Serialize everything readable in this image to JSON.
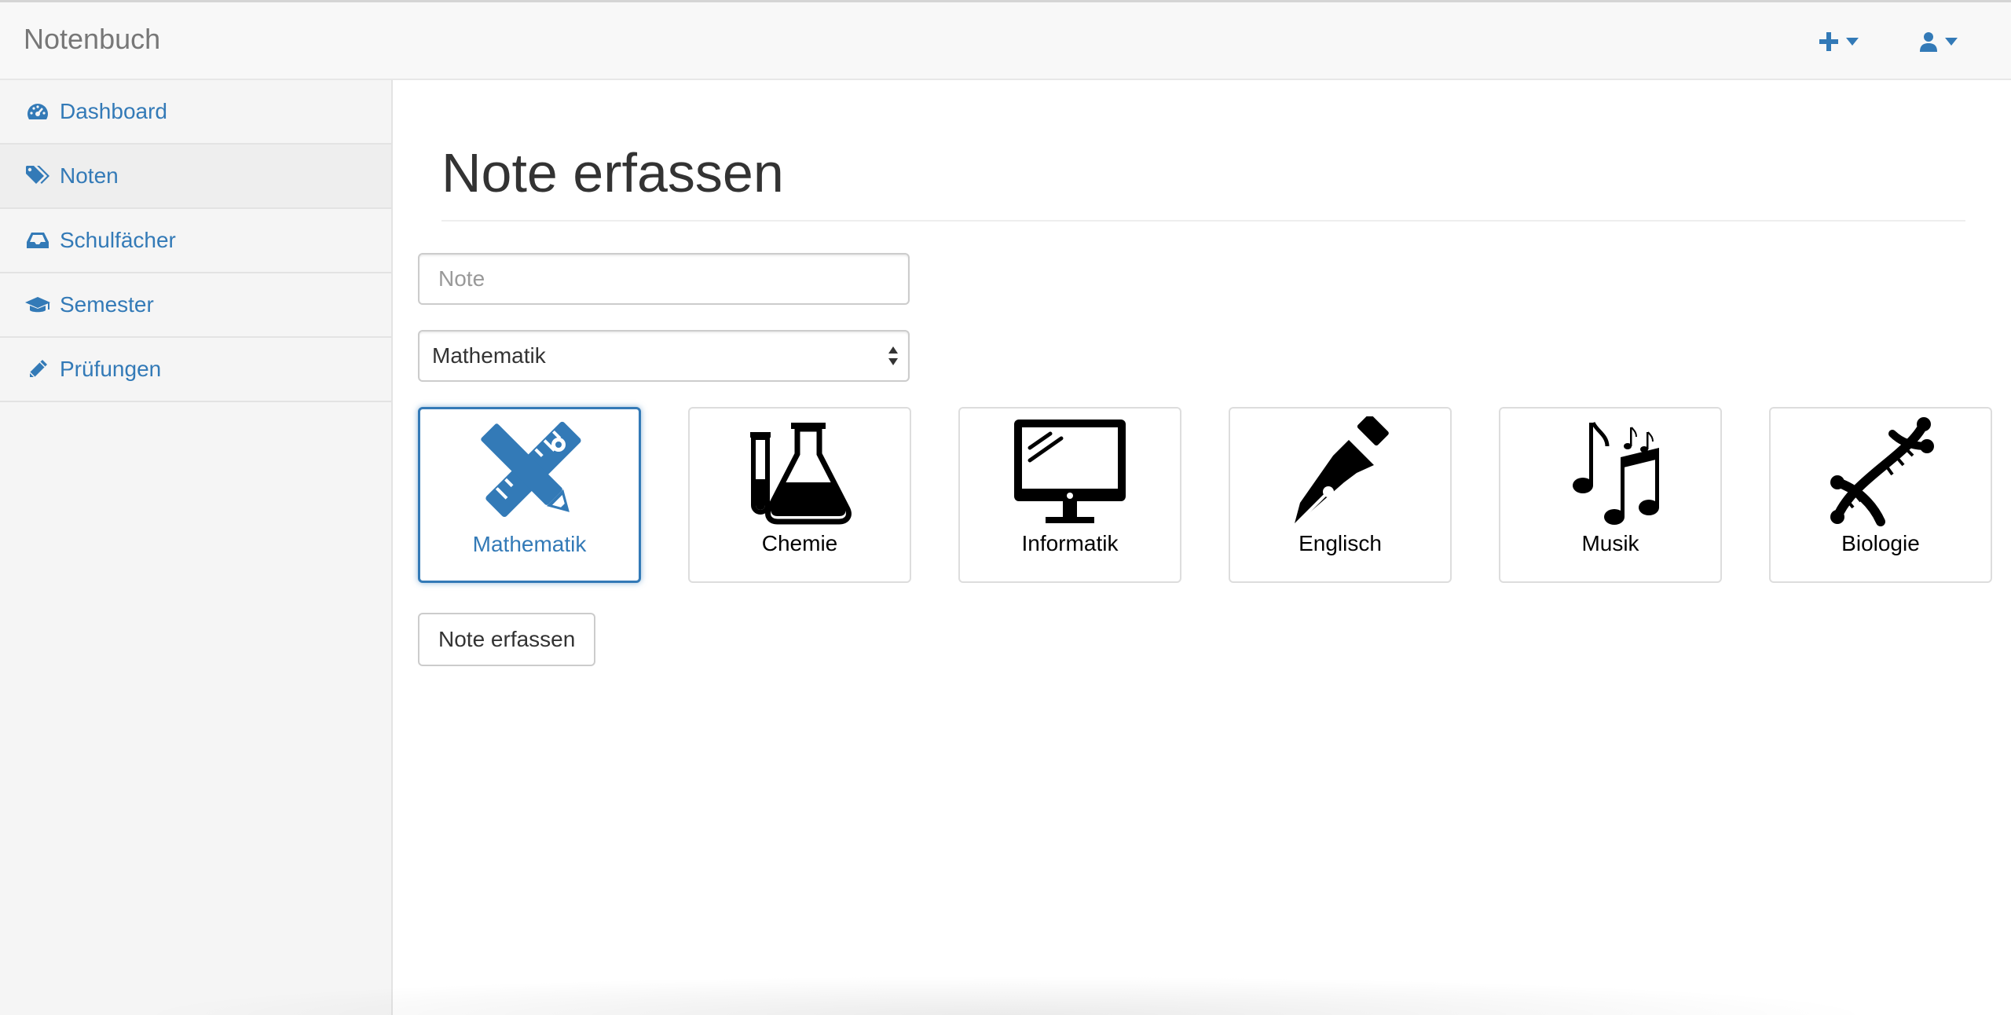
{
  "app": {
    "brand": "Notenbuch"
  },
  "navbar": {
    "add_menu_icon": "plus-icon",
    "user_menu_icon": "user-icon",
    "accent_color": "#337ab7"
  },
  "sidebar": {
    "items": [
      {
        "label": "Dashboard",
        "icon": "dashboard-icon",
        "active": false
      },
      {
        "label": "Noten",
        "icon": "tags-icon",
        "active": true
      },
      {
        "label": "Schulfächer",
        "icon": "inbox-icon",
        "active": false
      },
      {
        "label": "Semester",
        "icon": "graduation-cap-icon",
        "active": false
      },
      {
        "label": "Prüfungen",
        "icon": "pencil-icon",
        "active": false
      }
    ]
  },
  "main": {
    "title": "Note erfassen",
    "note_input": {
      "placeholder": "Note",
      "value": ""
    },
    "subject_select": {
      "selected": "Mathematik"
    },
    "subjects": [
      {
        "label": "Mathematik",
        "icon": "ruler-pencil-icon",
        "selected": true
      },
      {
        "label": "Chemie",
        "icon": "flask-icon",
        "selected": false
      },
      {
        "label": "Informatik",
        "icon": "monitor-icon",
        "selected": false
      },
      {
        "label": "Englisch",
        "icon": "fountain-pen-icon",
        "selected": false
      },
      {
        "label": "Musik",
        "icon": "music-notes-icon",
        "selected": false
      },
      {
        "label": "Biologie",
        "icon": "dna-icon",
        "selected": false
      }
    ],
    "submit_label": "Note erfassen"
  }
}
